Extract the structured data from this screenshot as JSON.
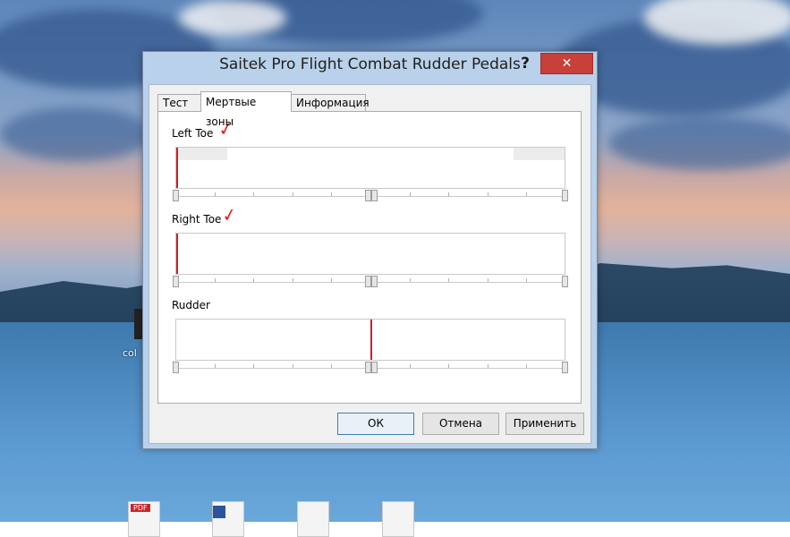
{
  "window": {
    "title": "Saitek Pro Flight Combat Rudder Pedals",
    "help_label": "?",
    "close_label": "✕"
  },
  "tabs": [
    {
      "label": "Тест",
      "active": false
    },
    {
      "label": "Мертвые зоны",
      "active": true
    },
    {
      "label": "Информация",
      "active": false
    }
  ],
  "axes": [
    {
      "label": "Left Toe",
      "annotated": true
    },
    {
      "label": "Right Toe",
      "annotated": true
    },
    {
      "label": "Rudder",
      "annotated": false
    }
  ],
  "buttons": {
    "ok": "ОК",
    "cancel": "Отмена",
    "apply": "Применить"
  },
  "desktop": {
    "icon_label_fragment": "col",
    "file_badge": "PDF"
  },
  "colors": {
    "accent_marker": "#cc2222",
    "annotation": "#e02020",
    "close_button": "#c7403a"
  }
}
